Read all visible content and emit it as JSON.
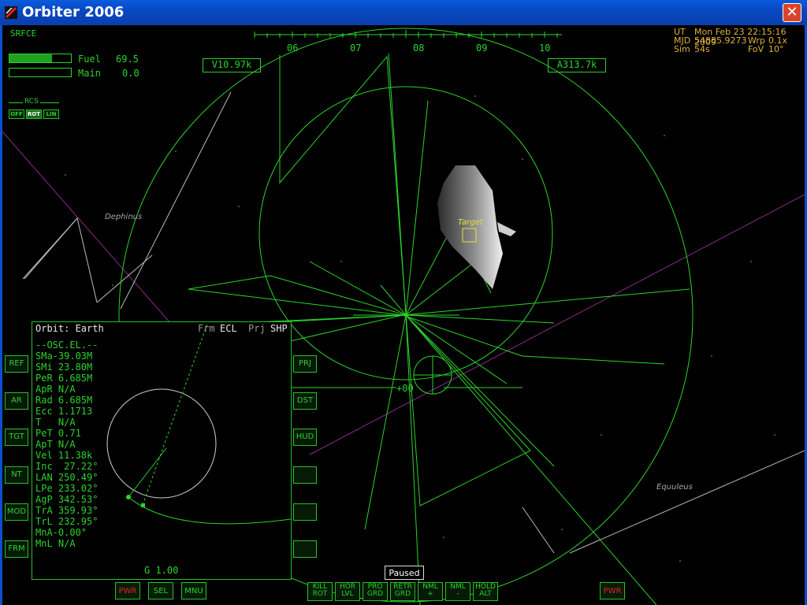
{
  "window": {
    "title": "Orbiter 2006",
    "close_glyph": "✕",
    "icon": "orbiter-logo-icon"
  },
  "hud": {
    "mode": "SRFCE",
    "velocity": "V10.97k",
    "altitude": "A313.7k",
    "heading_ticks": [
      "06",
      "07",
      "08",
      "09",
      "10"
    ],
    "pitch_marker": "+00",
    "target_label": "Target"
  },
  "gauges": {
    "fuel_label": "Fuel",
    "fuel_value": "69.5",
    "fuel_level_percent": 69.5,
    "main_label": "Main",
    "main_value": "0.0",
    "main_level_percent": 0
  },
  "rcs": {
    "label": "RCS",
    "buttons": [
      "OFF",
      "ROT",
      "LIN"
    ],
    "active": "ROT"
  },
  "info": {
    "ut_label": "UT",
    "ut_value": "Mon Feb 23 22:15:16 2009",
    "mjd_label": "MJD",
    "mjd_value": "54885.9273",
    "wrp_label": "Wrp",
    "wrp_value": "0.1x",
    "sim_label": "Sim",
    "sim_value": "54s",
    "fov_label": "FoV",
    "fov_value": "10°"
  },
  "constellations": {
    "delphinus": "Dephinus",
    "equuleus": "Equuleus"
  },
  "mfd": {
    "title": "Orbit: Earth",
    "frm_label": "Frm",
    "frm_value": "ECL",
    "prj_label": "Prj",
    "prj_value": "SHP",
    "lines": [
      "--OSC.EL.--",
      "SMa-39.03M",
      "SMi 23.80M",
      "PeR 6.685M",
      "ApR N/A",
      "Rad 6.685M",
      "Ecc 1.1713",
      "T   N/A",
      "PeT 0.71",
      "ApT N/A",
      "Vel 11.38k",
      "Inc  27.22°",
      "LAN 250.49°",
      "LPe 233.02°",
      "AgP 342.53°",
      "TrA 359.93°",
      "TrL 232.95°",
      "MnA-0.00°",
      "MnL N/A"
    ],
    "footer": "G 1.00",
    "left_buttons": [
      "REF",
      "AR",
      "TGT",
      "NT",
      "MOD",
      "FRM"
    ],
    "right_buttons": [
      "PRJ",
      "DST",
      "HUD",
      "",
      "",
      ""
    ],
    "bottom_buttons": [
      "PWR",
      "SEL",
      "MNU"
    ]
  },
  "autopilot": [
    [
      "KILL",
      "ROT"
    ],
    [
      "HOR",
      "LVL"
    ],
    [
      "PRO",
      "GRD"
    ],
    [
      "RETR",
      "GRD"
    ],
    [
      "NML",
      "+"
    ],
    [
      "NML",
      "-"
    ],
    [
      "HOLD",
      "ALT"
    ]
  ],
  "status": {
    "paused": "Paused"
  },
  "right_pwr": "PWR",
  "colors": {
    "hud_green": "#2bd32b",
    "info_amber": "#e0b03a",
    "titlebar_blue": "#0a5bdc",
    "warn_red": "#e02020"
  }
}
